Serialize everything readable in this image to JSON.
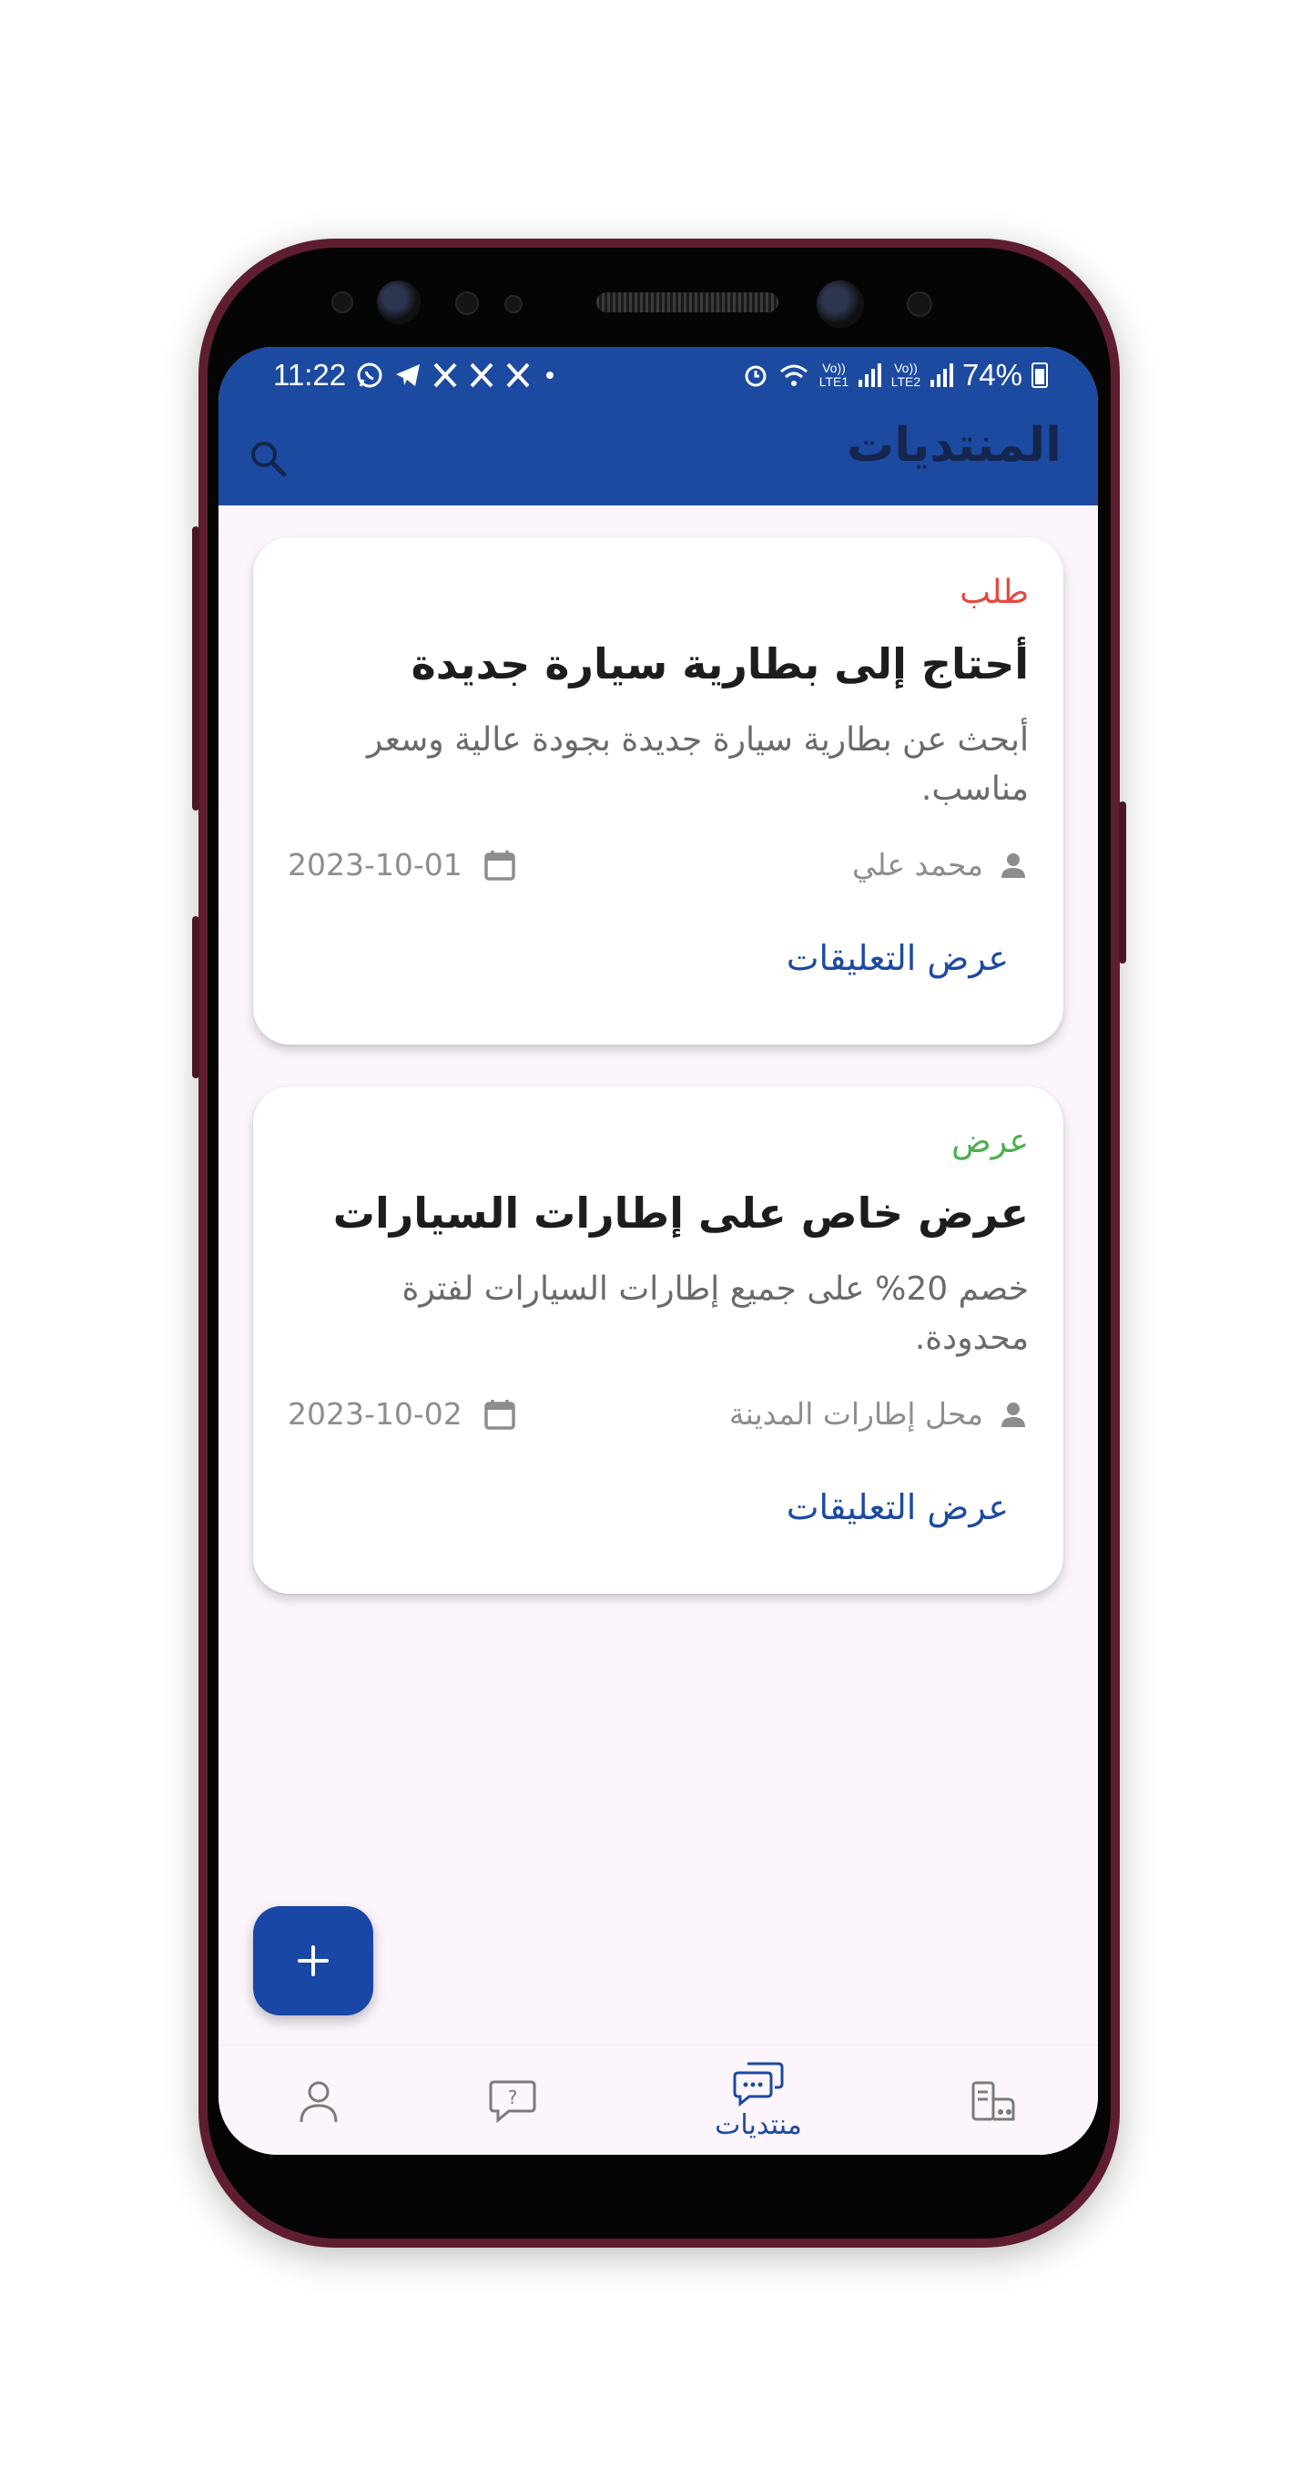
{
  "status_bar": {
    "time": "11:22",
    "battery_percent": "74%",
    "network_1": "Vo)) LTE1",
    "network_2": "Vo)) LTE2",
    "left_icons": [
      "whatsapp-icon",
      "telegram-icon",
      "x-icon",
      "x-icon",
      "x-icon",
      "dot-icon"
    ]
  },
  "app_bar": {
    "title": "المنتديات",
    "search_icon": "search-icon",
    "background_color": "#1c4aa1"
  },
  "posts": [
    {
      "type": "طلب",
      "type_color": "#e5483f",
      "title": "أحتاج إلى بطارية سيارة جديدة",
      "description": "أبحث عن بطارية سيارة جديدة بجودة عالية وسعر مناسب.",
      "author": "محمد علي",
      "date": "2023-10-01",
      "comments_label": "عرض التعليقات"
    },
    {
      "type": "عرض",
      "type_color": "#4caf50",
      "title": "عرض خاص على إطارات السيارات",
      "description": "خصم 20% على جميع إطارات السيارات لفترة محدودة.",
      "author": "محل إطارات المدينة",
      "date": "2023-10-02",
      "comments_label": "عرض التعليقات"
    }
  ],
  "fab": {
    "icon": "plus-icon"
  },
  "bottom_nav": {
    "items": [
      {
        "icon": "profile-icon",
        "label": ""
      },
      {
        "icon": "help-icon",
        "label": ""
      },
      {
        "icon": "forums-icon",
        "label": "منتديات",
        "active": true
      },
      {
        "icon": "catalog-icon",
        "label": ""
      }
    ],
    "active_color": "#1c4aa1"
  }
}
